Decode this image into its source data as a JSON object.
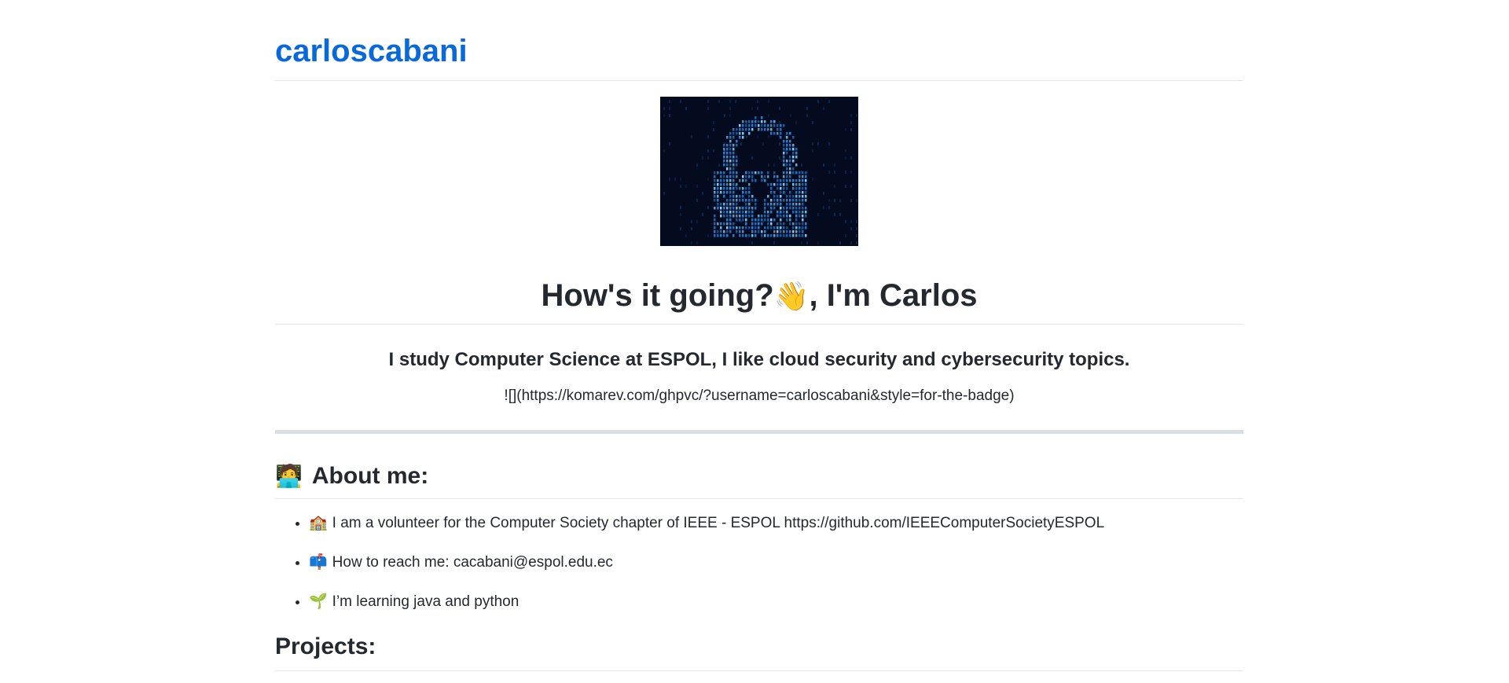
{
  "site": {
    "title": "carloscabani"
  },
  "hero": {
    "image_icon": "padlock-digital-icon",
    "colors": {
      "background": "#050b1e",
      "glow": "#1e88e5"
    }
  },
  "greeting": {
    "text": "How's it going?",
    "emoji": "👋",
    "suffix": ", I'm Carlos"
  },
  "intro": {
    "text": "I study Computer Science at ESPOL, I like cloud security and cybersecurity topics."
  },
  "badge": {
    "raw_text": "![](https://komarev.com/ghpvc/?username=carloscabani&style=for-the-badge)"
  },
  "about": {
    "emoji": "🧑‍💻",
    "heading": "About me:",
    "items": [
      {
        "emoji": "🏫",
        "icon": "school-icon",
        "text": "I am a volunteer for the Computer Society chapter of IEEE - ESPOL https://github.com/IEEEComputerSocietyESPOL"
      },
      {
        "emoji": "📫",
        "icon": "mailbox-icon",
        "text": "How to reach me: cacabani@espol.edu.ec"
      },
      {
        "emoji": "🌱",
        "icon": "seedling-icon",
        "text": "I’m learning java and python"
      }
    ]
  },
  "projects": {
    "heading": "Projects:"
  },
  "colors": {
    "link": "#0969da",
    "text": "#24292f",
    "divider": "#d8dee4"
  }
}
